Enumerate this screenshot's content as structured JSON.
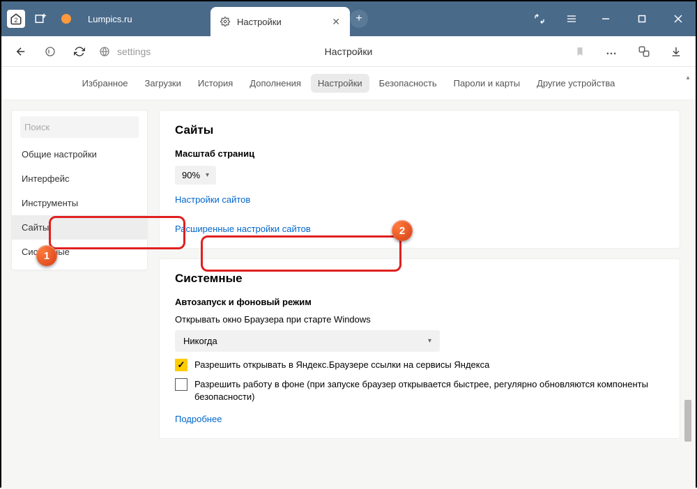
{
  "titlebar": {
    "home_badge": "2",
    "site_name": "Lumpics.ru",
    "tab_label": "Настройки"
  },
  "toolbar": {
    "address_text": "settings",
    "page_title": "Настройки"
  },
  "navtabs": {
    "items": [
      "Избранное",
      "Загрузки",
      "История",
      "Дополнения",
      "Настройки",
      "Безопасность",
      "Пароли и карты",
      "Другие устройства"
    ],
    "active_index": 4
  },
  "sidebar": {
    "search_placeholder": "Поиск",
    "items": [
      "Общие настройки",
      "Интерфейс",
      "Инструменты",
      "Сайты",
      "Системные"
    ],
    "active_index": 3
  },
  "sites_card": {
    "heading": "Сайты",
    "scale_label": "Масштаб страниц",
    "scale_value": "90%",
    "link_site_settings": "Настройки сайтов",
    "link_advanced": "Расширенные настройки сайтов"
  },
  "system_card": {
    "heading": "Системные",
    "autorun_label": "Автозапуск и фоновый режим",
    "open_on_start_label": "Открывать окно Браузера при старте Windows",
    "open_on_start_value": "Никогда",
    "checkbox_yandex_links": "Разрешить открывать в Яндекс.Браузере ссылки на сервисы Яндекса",
    "checkbox_background": "Разрешить работу в фоне (при запуске браузер открывается быстрее, регулярно обновляются компоненты безопасности)",
    "link_more": "Подробнее"
  },
  "badges": {
    "one": "1",
    "two": "2"
  }
}
